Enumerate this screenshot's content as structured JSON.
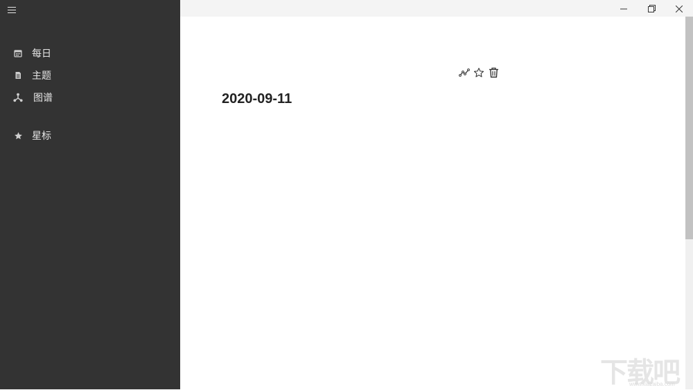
{
  "sidebar": {
    "items": [
      {
        "label": "每日",
        "icon": "calendar-icon"
      },
      {
        "label": "主题",
        "icon": "document-icon"
      },
      {
        "label": "图谱",
        "icon": "graph-icon"
      },
      {
        "label": "星标",
        "icon": "star-icon"
      }
    ]
  },
  "window": {
    "minimize": "minimize-icon",
    "restore": "restore-icon",
    "close": "close-icon"
  },
  "main": {
    "title": "2020-09-11",
    "tools": [
      "trend-icon",
      "star-outline-icon",
      "trash-icon"
    ]
  },
  "watermark": {
    "text": "下载吧",
    "url": "www.xiazaiba.com"
  },
  "colors": {
    "sidebar_bg": "#333333",
    "sidebar_text": "#e6e6e6",
    "titlebar_bg": "#f4f4f4"
  }
}
